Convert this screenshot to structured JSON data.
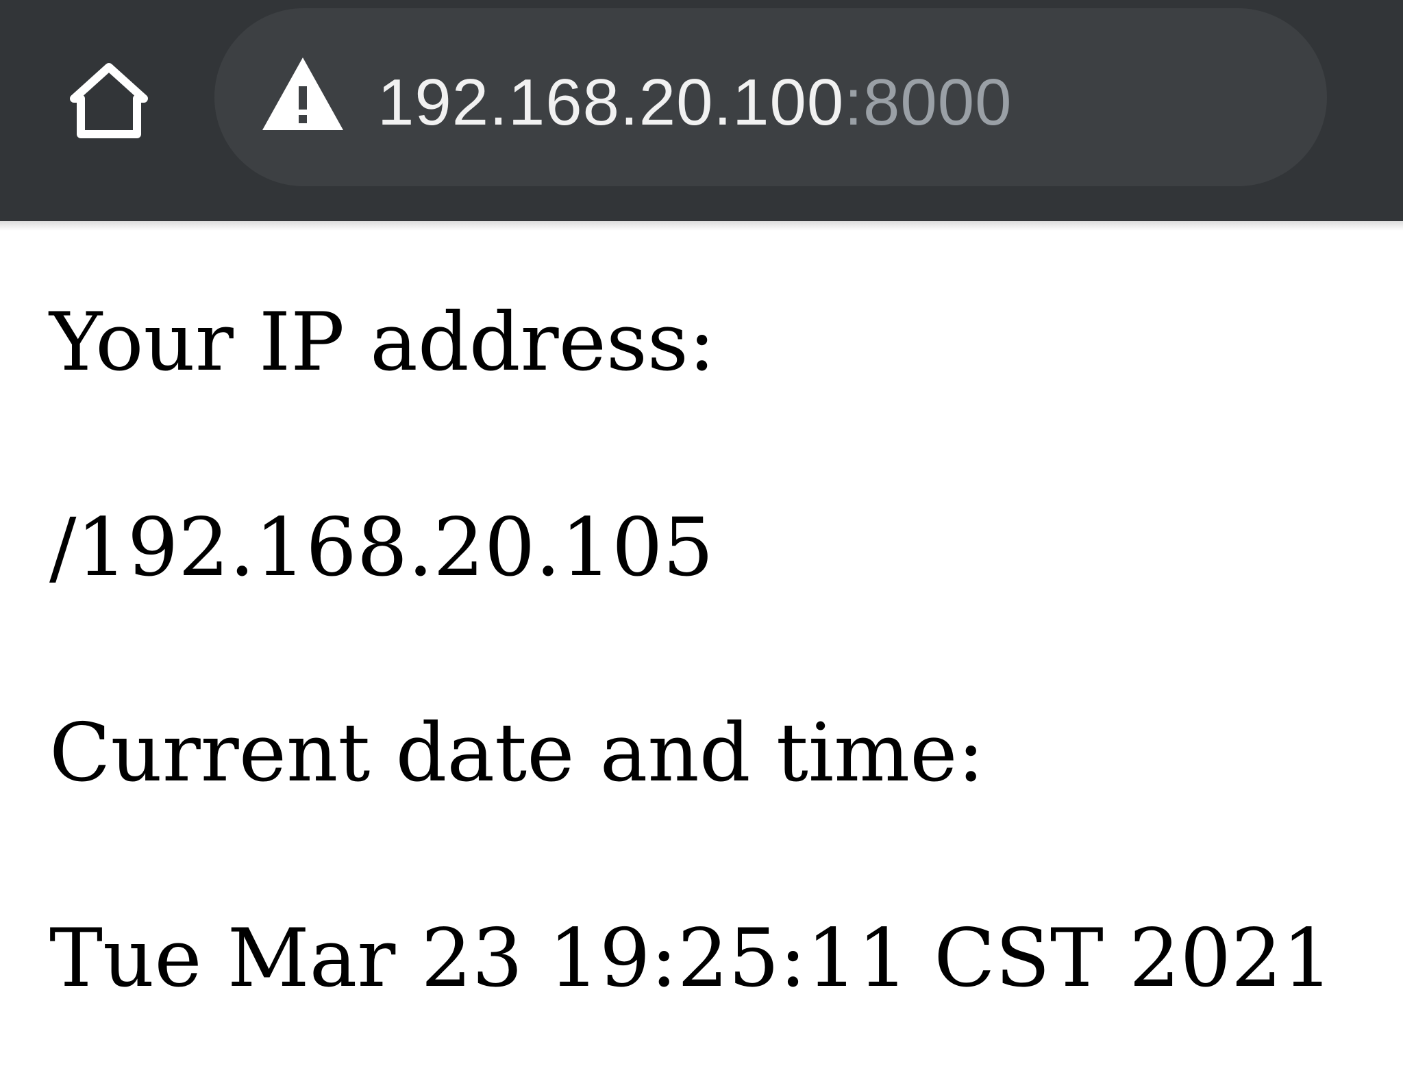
{
  "toolbar": {
    "home_icon": "home-icon",
    "security_icon": "warning-triangle-icon",
    "url_host": "192.168.20.100",
    "url_port": ":8000"
  },
  "page": {
    "ip_label": "Your IP address:",
    "ip_value": "/192.168.20.105",
    "datetime_label": "Current date and time:",
    "datetime_value": "Tue Mar 23 19:25:11 CST 2021"
  },
  "colors": {
    "toolbar_bg": "#323538",
    "url_bar_bg": "#3d4043",
    "url_text": "#f1f1f1",
    "url_port_text": "#9aa0a6",
    "page_bg": "#ffffff",
    "page_text": "#000000"
  }
}
